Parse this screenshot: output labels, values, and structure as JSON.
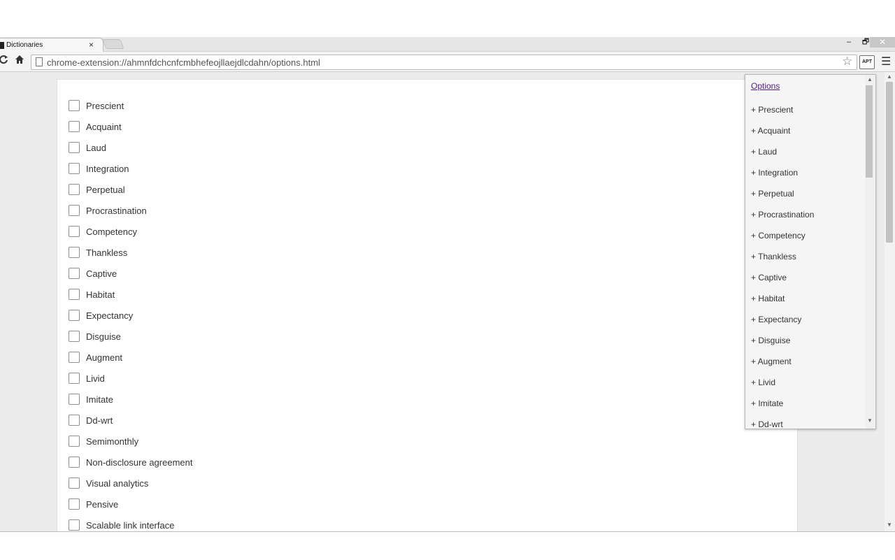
{
  "browser": {
    "tab_title": "Dictionaries",
    "tab_close_glyph": "×",
    "url": "chrome-extension://ahmnfdchcnfcmbhefeojllaejdlcdahn/options.html",
    "extension_badge": "APT",
    "window_controls": [
      "–",
      "🗗",
      "✕"
    ]
  },
  "page": {
    "words": [
      "Prescient",
      "Acquaint",
      "Laud",
      "Integration",
      "Perpetual",
      "Procrastination",
      "Competency",
      "Thankless",
      "Captive",
      "Habitat",
      "Expectancy",
      "Disguise",
      "Augment",
      "Livid",
      "Imitate",
      "Dd-wrt",
      "Semimonthly",
      "Non-disclosure agreement",
      "Visual analytics",
      "Pensive",
      "Scalable link interface"
    ]
  },
  "popup": {
    "options_link": "Options",
    "items": [
      "+ Prescient",
      "+ Acquaint",
      "+ Laud",
      "+ Integration",
      "+ Perpetual",
      "+ Procrastination",
      "+ Competency",
      "+ Thankless",
      "+ Captive",
      "+ Habitat",
      "+ Expectancy",
      "+ Disguise",
      "+ Augment",
      "+ Livid",
      "+ Imitate",
      "+ Dd-wrt"
    ]
  },
  "icons": {
    "reload": "reload-icon",
    "home": "home-icon",
    "page": "page-icon",
    "bookmark": "star-icon",
    "menu": "hamburger-menu-icon"
  }
}
